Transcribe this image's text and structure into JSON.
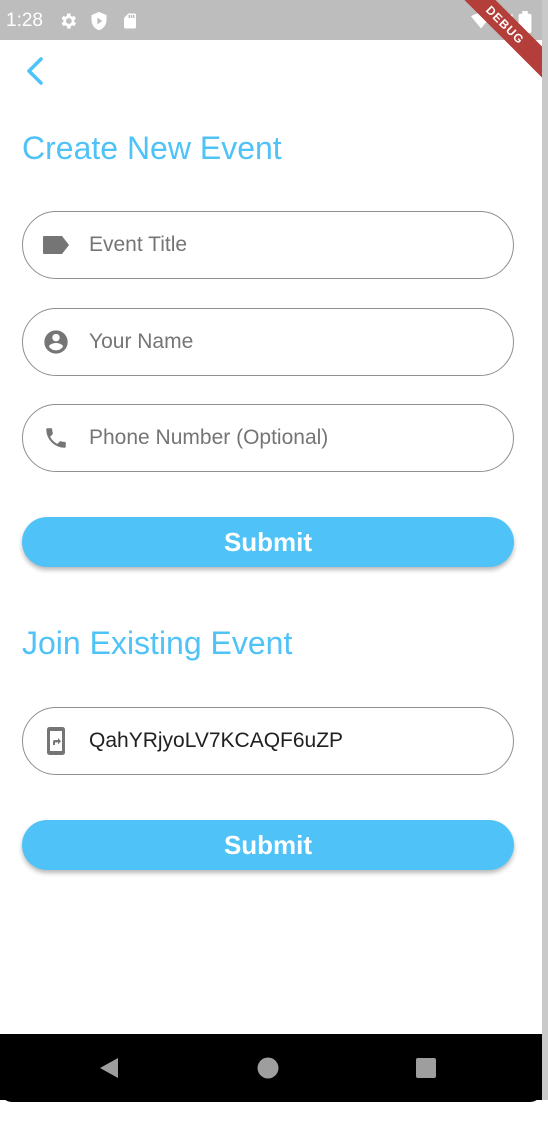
{
  "status_bar": {
    "time": "1:28",
    "debug_label": "DEBUG",
    "icons": [
      "settings-icon",
      "play-protect-icon",
      "sd-card-icon",
      "wifi-icon",
      "signal-icon",
      "battery-icon"
    ]
  },
  "colors": {
    "accent": "#4fc3f7",
    "status_bar": "#bdbdbd",
    "field_border": "#8f8f8f",
    "icon_gray": "#757575",
    "debug_ribbon": "#b43e3a"
  },
  "create_section": {
    "title": "Create New Event",
    "fields": [
      {
        "icon": "label-tag-icon",
        "placeholder": "Event Title",
        "value": ""
      },
      {
        "icon": "account-circle-icon",
        "placeholder": "Your Name",
        "value": ""
      },
      {
        "icon": "phone-icon",
        "placeholder": "Phone Number (Optional)",
        "value": ""
      }
    ],
    "submit_label": "Submit"
  },
  "join_section": {
    "title": "Join Existing Event",
    "field": {
      "icon": "mobile-forward-icon",
      "value": "QahYRjyoLV7KCAQF6uZP"
    },
    "submit_label": "Submit"
  },
  "nav_bar": {
    "buttons": [
      "back-triangle-icon",
      "home-circle-icon",
      "recents-square-icon"
    ]
  }
}
